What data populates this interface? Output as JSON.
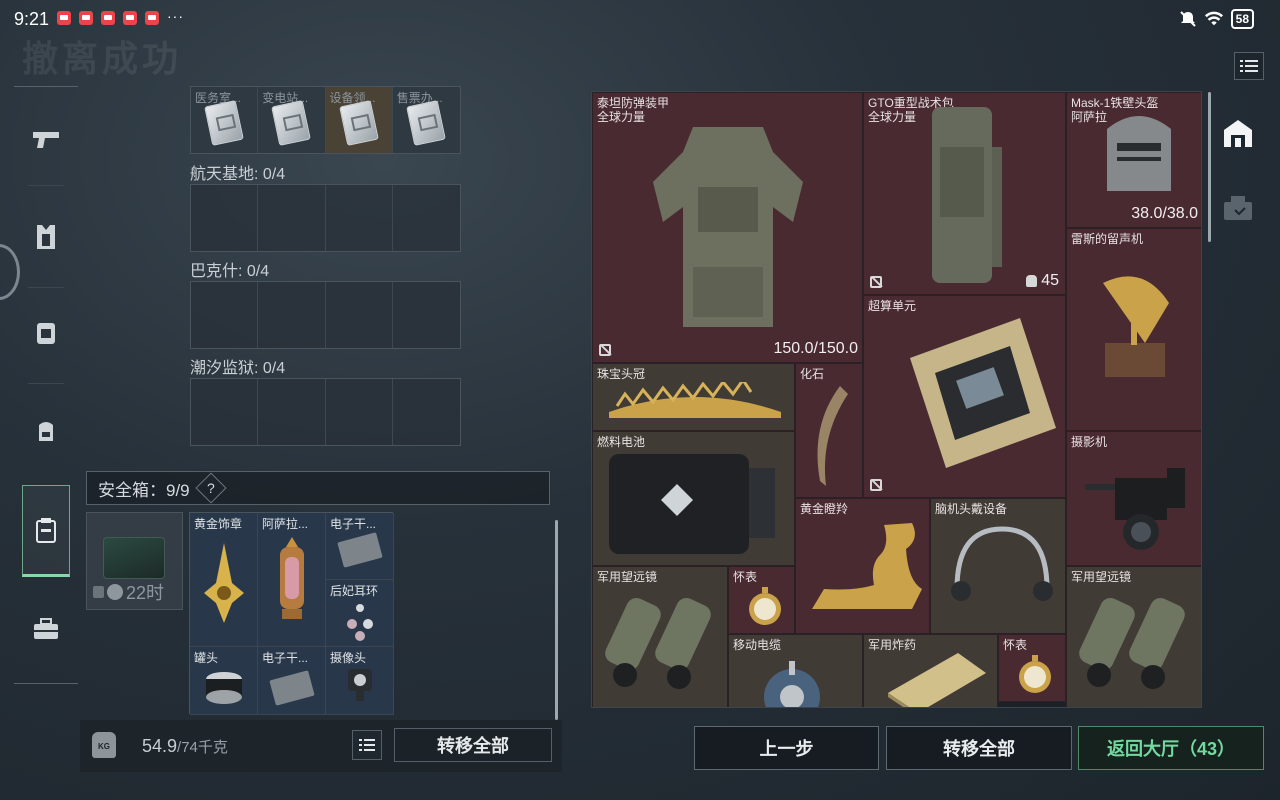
{
  "status_bar": {
    "time": "9:21",
    "more": "···",
    "battery": "58"
  },
  "page_title": "撤离成功",
  "stash": {
    "top_items": [
      "医务室...",
      "变电站...",
      "设备领...",
      "售票办..."
    ],
    "locations": [
      {
        "title": "航天基地: 0/4"
      },
      {
        "title": "巴克什: 0/4"
      },
      {
        "title": "潮汐监狱: 0/4"
      }
    ],
    "safebox_label": "安全箱：9/9",
    "safebox_help": "?",
    "case_timer": "22时",
    "safe_items": [
      {
        "label": "黄金饰章"
      },
      {
        "label": "阿萨拉..."
      },
      {
        "label": "电子干..."
      },
      {
        "label": "后妃耳环"
      },
      {
        "label": "罐头"
      },
      {
        "label": "电子干..."
      },
      {
        "label": "摄像头"
      }
    ],
    "weight_current": "54.9",
    "weight_max": "/74千克",
    "kg_badge": "KG",
    "transfer_all": "转移全部"
  },
  "loot": {
    "items": [
      {
        "name": "泰坦防弹装甲\n全球力量",
        "durability": "150.0/150.0"
      },
      {
        "name": "GTO重型战术包\n全球力量",
        "capacity": "45"
      },
      {
        "name": "Mask-1铁壁头盔\n阿萨拉",
        "durability": "38.0/38.0"
      },
      {
        "name": "雷斯的留声机"
      },
      {
        "name": "超算单元"
      },
      {
        "name": "珠宝头冠"
      },
      {
        "name": "化石"
      },
      {
        "name": "燃料电池"
      },
      {
        "name": "摄影机"
      },
      {
        "name": "黄金瞪羚"
      },
      {
        "name": "脑机头戴设备"
      },
      {
        "name": "军用望远镜"
      },
      {
        "name": "怀表"
      },
      {
        "name": "军用望远镜"
      },
      {
        "name": "移动电缆"
      },
      {
        "name": "军用炸药"
      },
      {
        "name": "怀表"
      }
    ]
  },
  "buttons": {
    "prev": "上一步",
    "transfer_all": "转移全部",
    "return_lobby": "返回大厅（43）"
  },
  "colors": {
    "loot_bg": "#4a2a31",
    "accent_green": "#74d9a0"
  }
}
